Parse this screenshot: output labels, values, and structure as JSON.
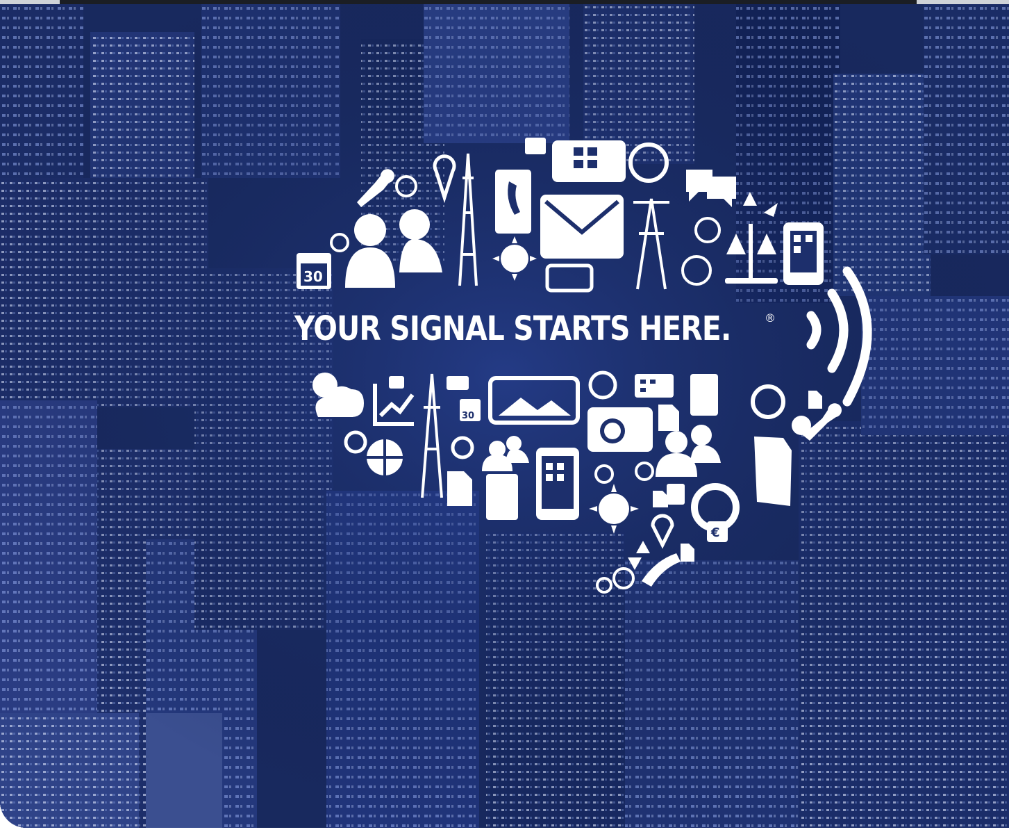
{
  "tagline": {
    "text": "YOUR SIGNAL STARTS HERE.",
    "registered_mark": "®"
  },
  "colors": {
    "background_blue": "#1a2b62",
    "icon_white": "#ffffff"
  },
  "icons": [
    "wrench-icon",
    "globe-icon",
    "antenna-icon",
    "cell-tower-icon",
    "phone-book-icon",
    "camera-icon",
    "tablet-icon",
    "clock-icon",
    "chat-bubbles-icon",
    "transfer-arrows-icon",
    "calendar-icon",
    "people-icon",
    "envelope-icon",
    "sun-icon",
    "scales-icon",
    "signal-waves-icon",
    "weather-icon",
    "chart-icon",
    "briefcase-icon",
    "photo-icon",
    "calculator-icon",
    "stopwatch-icon",
    "document-icon",
    "currency-exchange-icon",
    "folder-icon",
    "phone-icon"
  ]
}
